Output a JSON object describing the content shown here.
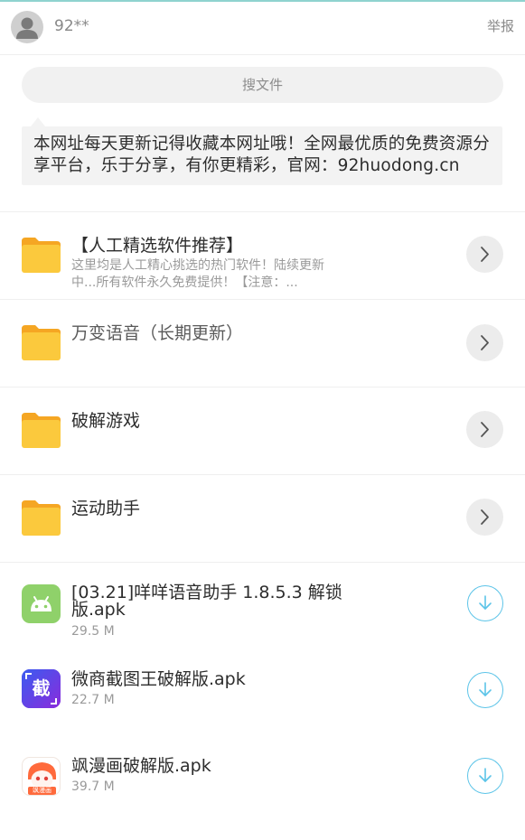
{
  "header": {
    "username": "92**",
    "report_label": "举报"
  },
  "search": {
    "placeholder": "搜文件"
  },
  "notice": {
    "text": "本网址每天更新记得收藏本网址哦！全网最优质的免费资源分享平台，乐于分享，有你更精彩，官网：92huodong.cn"
  },
  "folders": [
    {
      "title": "【人工精选软件推荐】",
      "description": "这里均是人工精心挑选的热门软件！陆续更新中...所有软件永久免费提供！【注意：..."
    },
    {
      "title": "万变语音（长期更新）",
      "description": ""
    },
    {
      "title": "破解游戏",
      "description": ""
    },
    {
      "title": "运动助手",
      "description": ""
    }
  ],
  "files": [
    {
      "name": "[03.21]咩咩语音助手 1.8.5.3 解锁版.apk",
      "size": "29.5 M",
      "icon": "android-icon"
    },
    {
      "name": "微商截图王破解版.apk",
      "size": "22.7 M",
      "icon": "screenshot-app-icon",
      "icon_text": "截"
    },
    {
      "name": "飒漫画破解版.apk",
      "size": "39.7 M",
      "icon": "manga-app-icon",
      "icon_text": "飒漫画"
    }
  ],
  "colors": {
    "accent": "#5cc4e8",
    "folder": "#fbc93d",
    "android": "#8fd16a",
    "screenshot_app": "#5b3fe0",
    "manga_app": "#ff6a3c"
  }
}
